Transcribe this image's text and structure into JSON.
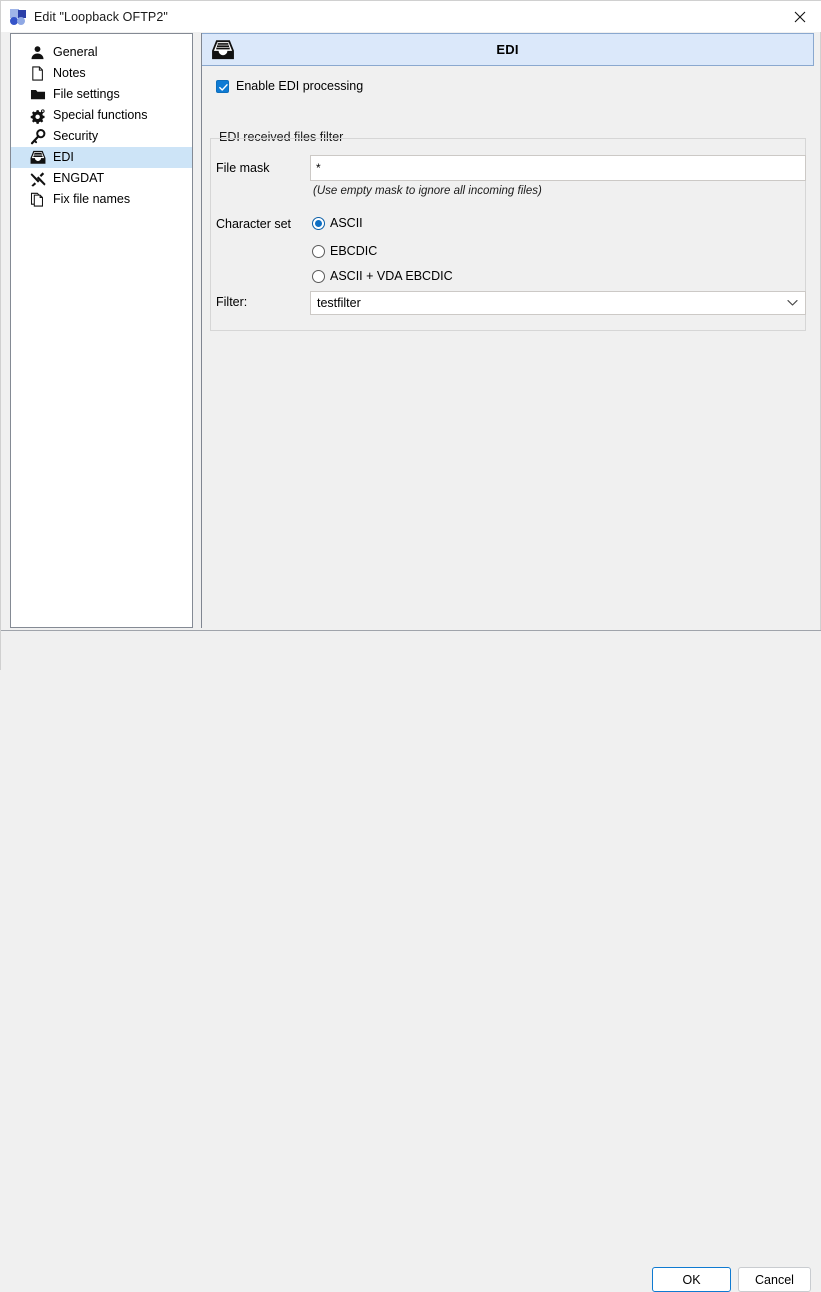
{
  "window": {
    "title": "Edit \"Loopback OFTP2\"",
    "app_icon": "app-logo-icon",
    "close_icon": "close-icon"
  },
  "sidebar": {
    "items": [
      {
        "label": "General",
        "icon": "user-icon",
        "selected": false
      },
      {
        "label": "Notes",
        "icon": "document-icon",
        "selected": false
      },
      {
        "label": "File settings",
        "icon": "folder-icon",
        "selected": false
      },
      {
        "label": "Special functions",
        "icon": "gear-icon",
        "selected": false
      },
      {
        "label": "Security",
        "icon": "key-icon",
        "selected": false
      },
      {
        "label": "EDI",
        "icon": "inbox-tray-icon",
        "selected": true
      },
      {
        "label": "ENGDAT",
        "icon": "tools-icon",
        "selected": false
      },
      {
        "label": "Fix file names",
        "icon": "copy-document-icon",
        "selected": false
      }
    ]
  },
  "panel": {
    "header_title": "EDI",
    "header_icon": "inbox-tray-icon",
    "enable_checkbox": {
      "label": "Enable EDI processing",
      "checked": true
    },
    "group": {
      "title": "EDI received files filter",
      "file_mask": {
        "label": "File mask",
        "value": "*",
        "placeholder": "",
        "hint": "(Use empty mask to ignore all incoming files)"
      },
      "character_set": {
        "label": "Character set",
        "options": [
          {
            "label": "ASCII",
            "selected": true
          },
          {
            "label": "EBCDIC",
            "selected": false
          },
          {
            "label": "ASCII + VDA EBCDIC",
            "selected": false
          }
        ]
      },
      "filter": {
        "label": "Filter:",
        "value": "testfilter",
        "arrow_icon": "chevron-down-icon"
      }
    }
  },
  "footer": {
    "ok_label": "OK",
    "cancel_label": "Cancel"
  },
  "colors": {
    "accent": "#0f7bd4",
    "header_bg": "#dbe8fa",
    "selection_bg": "#cde4f7",
    "window_bg": "#f0f0f0"
  }
}
